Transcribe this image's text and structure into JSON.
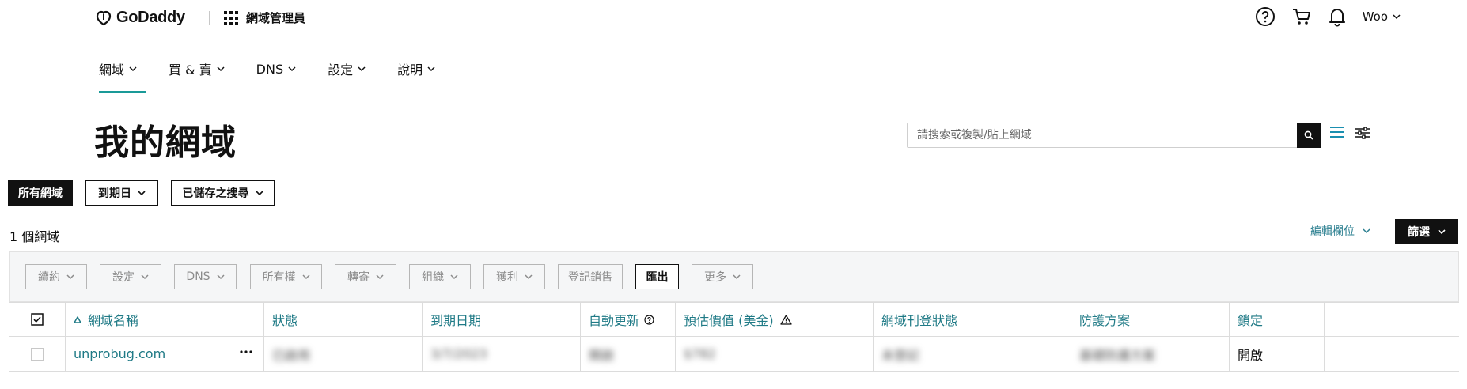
{
  "header": {
    "brand": "GoDaddy",
    "app_title": "網域管理員",
    "user_name": "Woo"
  },
  "nav": {
    "items": [
      {
        "label": "網域"
      },
      {
        "label": "買 & 賣"
      },
      {
        "label": "DNS"
      },
      {
        "label": "設定"
      },
      {
        "label": "說明"
      }
    ]
  },
  "page": {
    "title": "我的網域",
    "search_placeholder": "請搜索或複製/貼上網域"
  },
  "filters": {
    "all_domains": "所有網域",
    "expiry": "到期日",
    "saved_searches": "已儲存之搜尋"
  },
  "summary": {
    "count_text": "1 個網域",
    "edit_columns": "編輯欄位",
    "filter": "篩選"
  },
  "actions": {
    "renew": "續約",
    "settings": "設定",
    "dns": "DNS",
    "ownership": "所有權",
    "forwarding": "轉寄",
    "organize": "組織",
    "monetize": "獲利",
    "list_for_sale": "登記銷售",
    "export": "匯出",
    "more": "更多"
  },
  "table": {
    "columns": {
      "domain": "網域名稱",
      "status": "狀態",
      "expiry": "到期日期",
      "auto_renew": "自動更新",
      "est_value": "預估價值 (美金)",
      "listing_status": "網域刊登狀態",
      "protection": "防護方案",
      "lock": "鎖定"
    },
    "rows": [
      {
        "domain": "unprobug.com",
        "status": "已啟用",
        "expiry": "3/7/2023",
        "auto_renew": "開啟",
        "est_value": "$782",
        "listing_status": "未登記",
        "protection": "基礎防護方案",
        "lock": "開啟"
      }
    ]
  },
  "colors": {
    "accent": "#1a9a98",
    "link": "#1f7a86",
    "dark": "#111111"
  }
}
